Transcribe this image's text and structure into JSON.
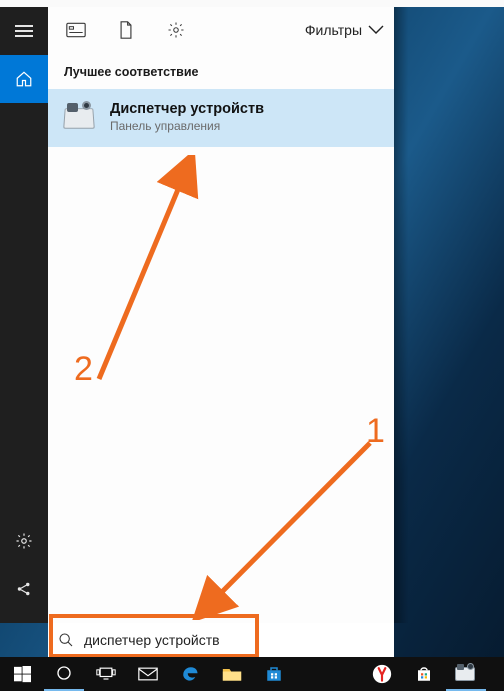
{
  "panel": {
    "filters_label": "Фильтры",
    "section_best_match": "Лучшее соответствие",
    "result": {
      "title": "Диспетчер устройств",
      "subtitle": "Панель управления"
    }
  },
  "search": {
    "value": "диспетчер устройств"
  },
  "annotations": {
    "label1": "1",
    "label2": "2"
  },
  "rail": {
    "menu": "menu",
    "home": "home",
    "settings": "settings",
    "share": "share"
  },
  "top_icons": {
    "apps": "apps",
    "documents": "documents",
    "settings": "settings"
  },
  "taskbar": {
    "start": "start",
    "cortana": "cortana",
    "task_view": "task-view",
    "mail": "mail",
    "edge": "edge",
    "explorer": "file-explorer",
    "store": "store",
    "yandex": "yandex",
    "bag": "store-bag",
    "devmgr": "device-manager"
  }
}
